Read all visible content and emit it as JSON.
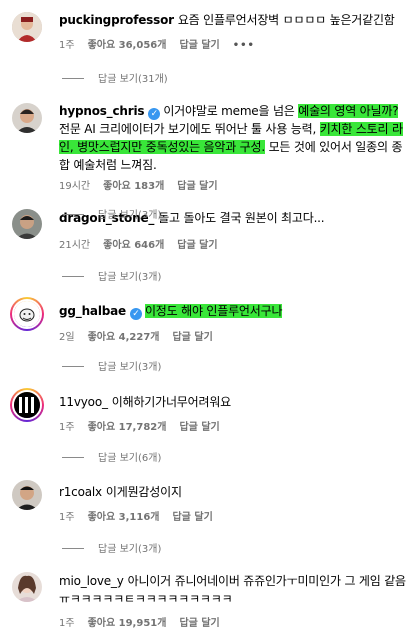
{
  "comments": [
    {
      "username": "puckingprofessor",
      "text_plain": "요즘 인플루언서장벽 ㅁㅁㅁㅁ 높은거같긴함",
      "time": "1주",
      "likes": "좋아요 36,056개",
      "reply": "답글 달기",
      "more": "•••",
      "view_replies": "답글 보기(31개)"
    },
    {
      "username": "hypnos_chris",
      "verified": true,
      "text_a": "이거야말로 meme을 넘은 ",
      "text_hl1": "예술의 영역 아닐까?",
      "text_b": " 전문 AI 크리에이터가 보기에도 뛰어난 툴 사용 능력, ",
      "text_hl2": "키치한 스토리 라인, 병맛스럽지만 중독성있는 음악과 구성.",
      "text_c": " 모든 것에 있어서 일종의 종합 예술처럼 느껴짐.",
      "time": "19시간",
      "likes": "좋아요 183개",
      "reply": "답글 달기",
      "view_replies": "답글 보기(3개)"
    },
    {
      "username": "dragon_stone_",
      "text_plain": "돌고 돌아도 결국 원본이 최고다...",
      "time": "21시간",
      "likes": "좋아요 646개",
      "reply": "답글 달기",
      "view_replies": "답글 보기(3개)"
    },
    {
      "username": "gg_halbae",
      "verified": true,
      "text_hl": "이정도 해야 인플루언서구나",
      "time": "2일",
      "likes": "좋아요 4,227개",
      "reply": "답글 달기",
      "view_replies": "답글 보기(3개)"
    },
    {
      "username": "11vyoo_",
      "text_plain": "이해하기가너무어려워요",
      "time": "1주",
      "likes": "좋아요 17,782개",
      "reply": "답글 달기",
      "view_replies": "답글 보기(6개)"
    },
    {
      "username": "r1coalx",
      "text_plain": "이게뭔감성이지",
      "time": "1주",
      "likes": "좋아요 3,116개",
      "reply": "답글 달기",
      "view_replies": "답글 보기(3개)"
    },
    {
      "username": "mio_love_y",
      "text_plain": "아니이거 쥬니어네이버 쥬쥬인가ㅜ미미인가 그 게임 같음 ㅠㅋㅋㅋㅋㅋㅌㅋㅋㅋㅋㅋㅋㅋㅋㅋ",
      "time": "1주",
      "likes": "좋아요 19,951개",
      "reply": "답글 달기"
    }
  ],
  "colors": {
    "highlight": "#39e639",
    "meta_text": "#737373",
    "verified": "#3897f0"
  },
  "icons": [
    "verified-badge-icon",
    "more-options-icon"
  ]
}
